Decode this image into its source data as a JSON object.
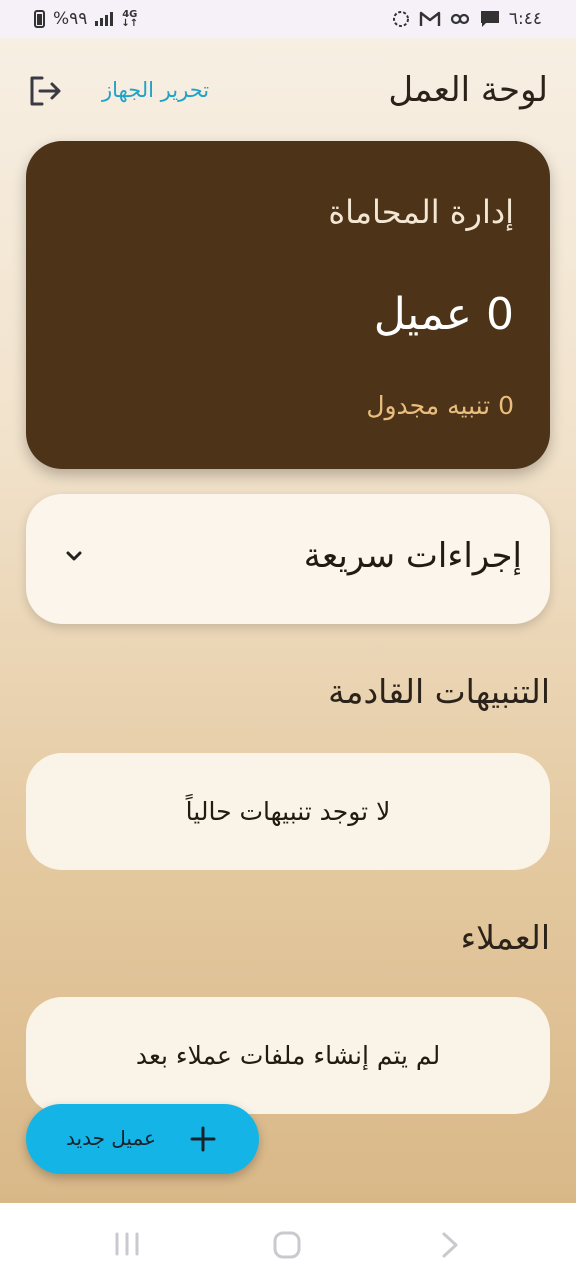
{
  "status_bar": {
    "time": "٦:٤٤",
    "battery": "%٩٩",
    "network": "4G"
  },
  "header": {
    "title": "لوحة العمل",
    "edit_device": "تحرير الجهاز"
  },
  "summary": {
    "title": "إدارة المحاماة",
    "clients_count": "0 عميل",
    "scheduled_alerts": "0 تنبيه مجدول"
  },
  "quick_actions": {
    "label": "إجراءات سريعة"
  },
  "alerts_section": {
    "title": "التنبيهات القادمة",
    "empty_message": "لا توجد تنبيهات حالياً"
  },
  "clients_section": {
    "title": "العملاء",
    "empty_message": "لم يتم إنشاء ملفات عملاء بعد"
  },
  "fab": {
    "label": "عميل جديد"
  },
  "colors": {
    "summary_card": "#4d3317",
    "accent": "#14b5e6",
    "link": "#1fa3c8",
    "alerts_text": "#e9bd7e"
  }
}
